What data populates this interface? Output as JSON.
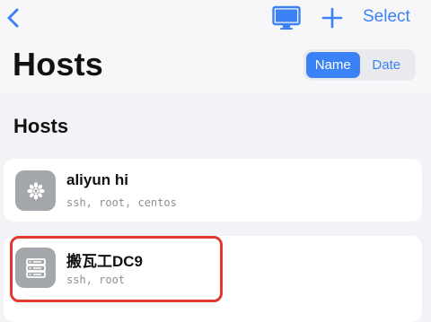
{
  "navbar": {
    "back_icon": "chevron-left-icon",
    "monitor_icon": "monitor-icon",
    "plus_icon": "plus-icon",
    "select_label": "Select",
    "accent_color": "#3b82f6"
  },
  "header": {
    "title": "Hosts"
  },
  "sort_control": {
    "options": [
      "Name",
      "Date"
    ],
    "selected": "Name"
  },
  "section": {
    "title": "Hosts"
  },
  "hosts": [
    {
      "name": "aliyun hi",
      "detail": "ssh, root, centos",
      "icon": "cloud-host-icon"
    },
    {
      "name": "搬瓦工DC9",
      "detail": "ssh, root",
      "icon": "server-icon",
      "highlighted": true
    }
  ],
  "highlight_color": "#e03a2f"
}
